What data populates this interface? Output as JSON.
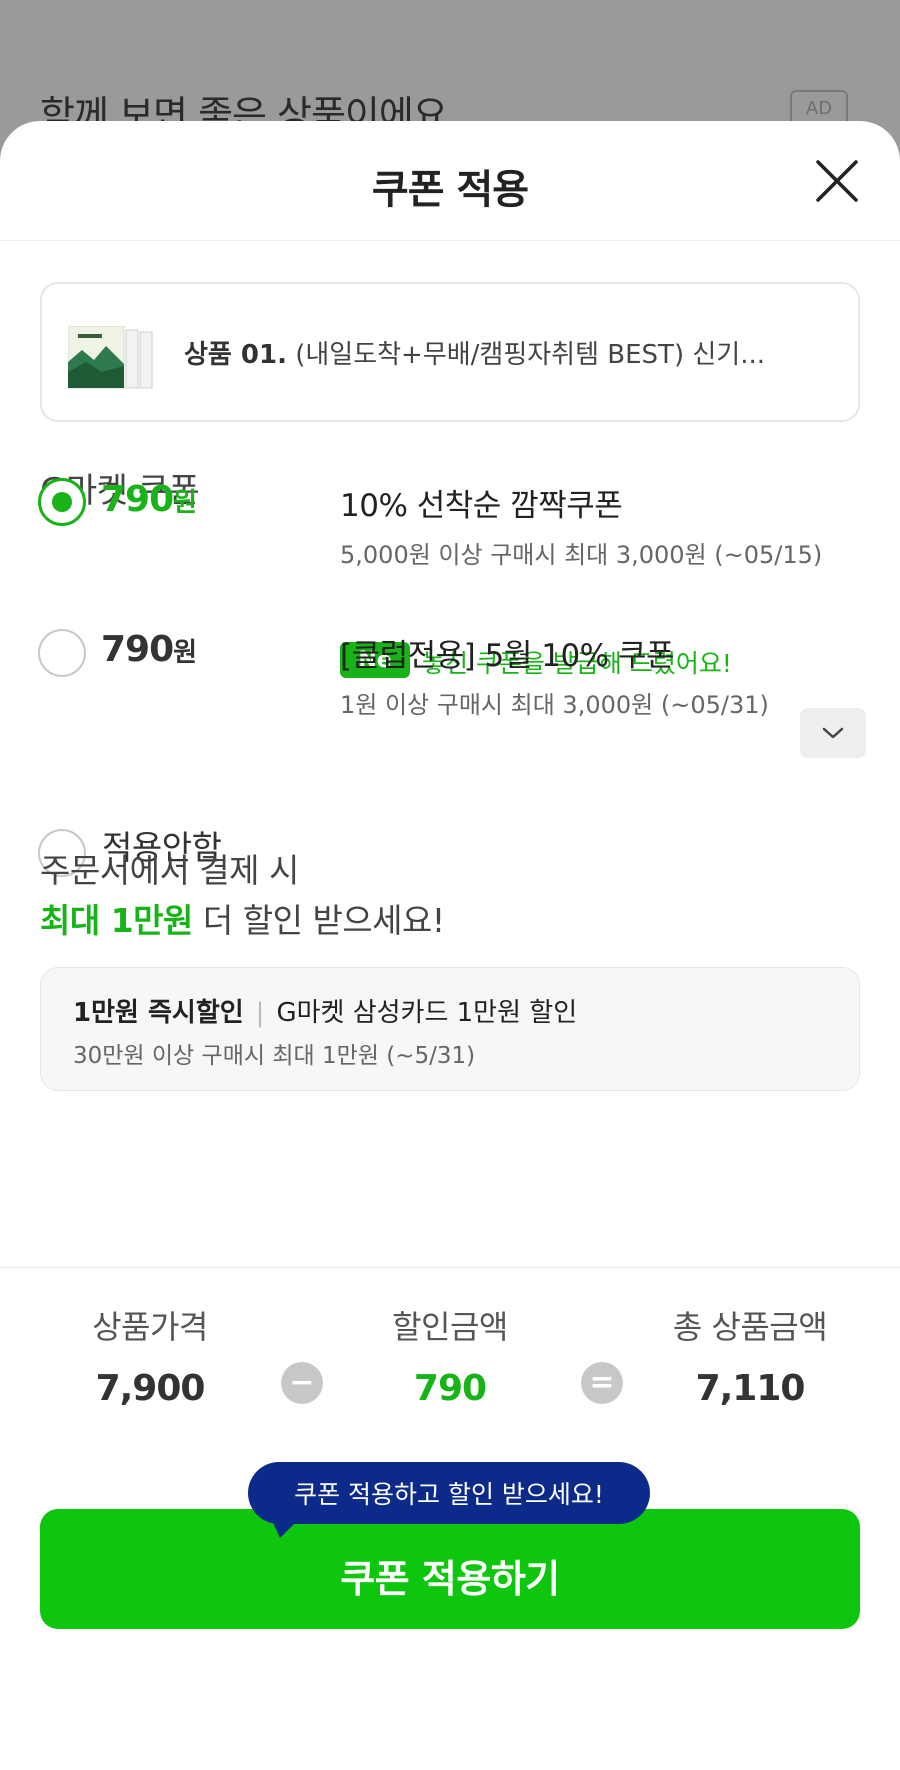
{
  "background": {
    "title": "함께 보면 좋은 상품이에요",
    "ad_label": "AD"
  },
  "sheet": {
    "title": "쿠폰 적용",
    "close_icon": "close-icon"
  },
  "product": {
    "name_bold": "상품 01.",
    "name_rest": " (내일도착+무배/캠핑자취템 BEST) 신기..."
  },
  "coupons": {
    "section_title": "G마켓 쿠폰",
    "items": [
      {
        "amount": "790",
        "unit": "원",
        "name": "10% 선착순 깜짝쿠폰",
        "condition": "5,000원 이상 구매시 최대 3,000원 (~05/15)",
        "badge": "Ne",
        "badge_message": "놓친 쿠폰을 발급해 드렸어요!",
        "selected": true
      },
      {
        "amount": "790",
        "unit": "원",
        "name": "[클럽전용] 5월 10% 쿠폰",
        "condition": "1원 이상 구매시 최대 3,000원 (~05/31)",
        "selected": false
      }
    ],
    "no_apply_label": "적용안함"
  },
  "promo": {
    "line1": "주문서에서 결제 시",
    "line2_highlight": "최대 1만원",
    "line2_rest": " 더 할인 받으세요!",
    "card_title_bold": "1만원 즉시할인",
    "card_sep": "|",
    "card_title_rest": "G마켓 삼성카드 1만원 할인",
    "card_condition": "30만원 이상 구매시 최대 1만원 (~5/31)"
  },
  "summary": {
    "price_label": "상품가격",
    "price_value": "7,900",
    "minus": "−",
    "discount_label": "할인금액",
    "discount_value": "790",
    "equals": "=",
    "total_label": "총 상품금액",
    "total_value": "7,110"
  },
  "tooltip": "쿠폰 적용하고 할인 받으세요!",
  "apply_button": "쿠폰 적용하기",
  "colors": {
    "accent": "#17b317",
    "button": "#0fc60f",
    "tooltip": "#0b2a8a"
  }
}
